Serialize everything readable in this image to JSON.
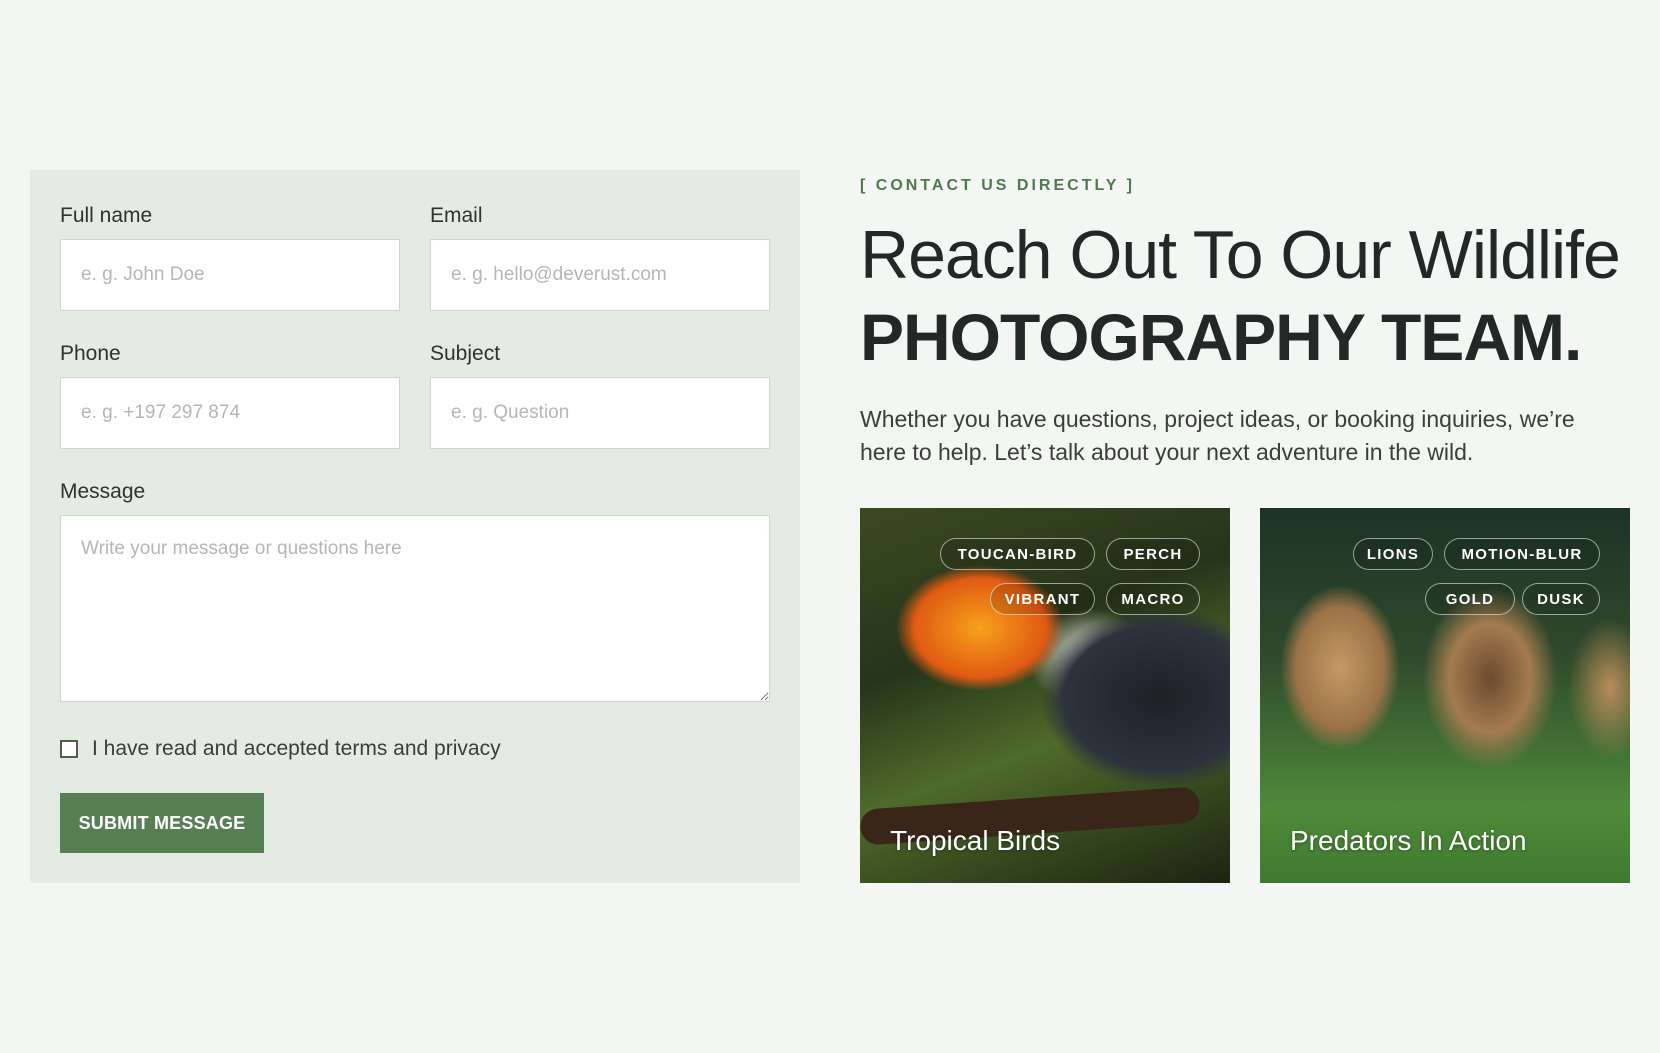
{
  "form": {
    "fullname": {
      "label": "Full name",
      "placeholder": "e. g. John Doe"
    },
    "email": {
      "label": "Email",
      "placeholder": "e. g. hello@deverust.com"
    },
    "phone": {
      "label": "Phone",
      "placeholder": "e. g. +197 297 874"
    },
    "subject": {
      "label": "Subject",
      "placeholder": "e. g. Question"
    },
    "message": {
      "label": "Message",
      "placeholder": "Write your message or questions here"
    },
    "terms_label": "I have read and accepted terms and privacy",
    "submit_label": "SUBMIT MESSAGE"
  },
  "contact": {
    "eyebrow": "[ CONTACT US DIRECTLY ]",
    "heading_light": "Reach Out To Our Wildlife",
    "heading_bold": "PHOTOGRAPHY TEAM.",
    "lead": "Whether you have questions, project ideas, or booking inquiries, we’re here to help. Let’s talk about your next adventure in the wild."
  },
  "cards": [
    {
      "title": "Tropical Birds",
      "tags": [
        "TOUCAN-BIRD",
        "PERCH",
        "VIBRANT",
        "MACRO"
      ]
    },
    {
      "title": "Predators In Action",
      "tags": [
        "LIONS",
        "MOTION-BLUR",
        "GOLD",
        "DUSK"
      ]
    }
  ]
}
